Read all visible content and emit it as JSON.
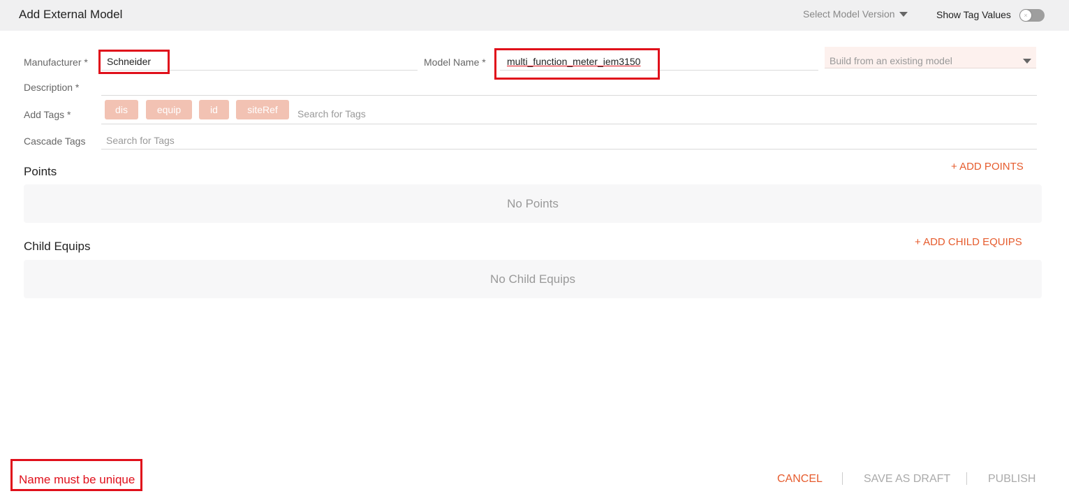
{
  "header": {
    "title": "Add External Model",
    "version_label": "Select Model Version",
    "tag_values_label": "Show Tag Values",
    "toggle_icon": "close-icon"
  },
  "form": {
    "manufacturer_label": "Manufacturer *",
    "manufacturer_value": "Schneider",
    "model_name_label": "Model Name *",
    "model_name_value": "multi_function_meter_iem3150",
    "build_from_placeholder": "Build from an existing model",
    "description_label": "Description *",
    "add_tags_label": "Add Tags *",
    "tags": [
      "dis",
      "equip",
      "id",
      "siteRef"
    ],
    "tags_placeholder": "Search for Tags",
    "cascade_tags_label": "Cascade Tags",
    "cascade_placeholder": "Search for Tags"
  },
  "points": {
    "title": "Points",
    "add_label": "+ ADD POINTS",
    "empty_text": "No Points"
  },
  "child_equips": {
    "title": "Child Equips",
    "add_label": "+ ADD CHILD EQUIPS",
    "empty_text": "No Child Equips"
  },
  "footer": {
    "error_text": "Name must be unique",
    "cancel_label": "CANCEL",
    "save_draft_label": "SAVE AS DRAFT",
    "publish_label": "PUBLISH"
  },
  "colors": {
    "accent": "#e65c2e",
    "error": "#e0101b",
    "chip": "#f2c2b3"
  }
}
